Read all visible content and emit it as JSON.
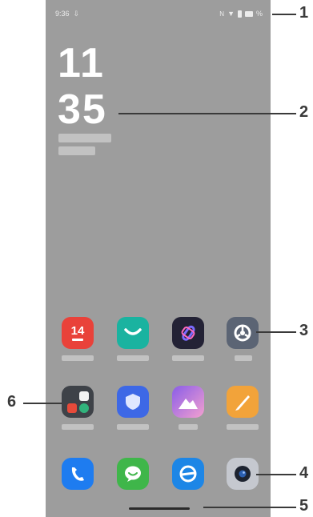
{
  "status_bar": {
    "time": "9:36",
    "battery": "%"
  },
  "clock": {
    "hour": "11",
    "minute": "35"
  },
  "apps": {
    "calendar_date": "14"
  },
  "callouts": {
    "c1": "1",
    "c2": "2",
    "c3": "3",
    "c4": "4",
    "c5": "5",
    "c6": "6"
  },
  "colors": {
    "background": "#9d9d9d",
    "callout": "#3a3a3a"
  }
}
